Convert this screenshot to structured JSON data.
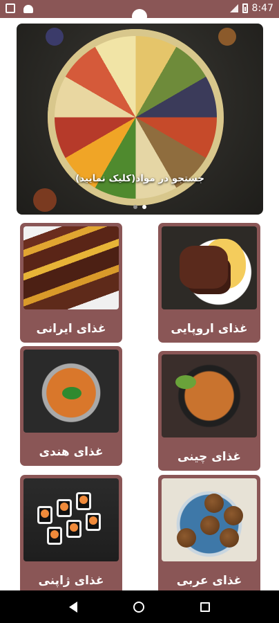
{
  "status_bar": {
    "time": "8:47",
    "icons": [
      "square-icon",
      "android-icon",
      "signal-icon",
      "battery-icon"
    ]
  },
  "hero": {
    "caption": "جستجو در مواد(کلیک نمایید)",
    "pages": 2,
    "active_page": 2
  },
  "categories": [
    {
      "label": "غذای اروپایی",
      "image": "european-dish"
    },
    {
      "label": "غذای ایرانی",
      "image": "iranian-kebab"
    },
    {
      "label": "غذای چینی",
      "image": "chinese-noodles"
    },
    {
      "label": "غذای هندی",
      "image": "indian-rice"
    },
    {
      "label": "غذای عربی",
      "image": "arabic-falafel"
    },
    {
      "label": "غذای ژاپنی",
      "image": "japanese-sushi"
    }
  ],
  "colors": {
    "primary": "#8a5656",
    "background": "#ffffff",
    "nav_bar": "#000000"
  },
  "nav": [
    "back-icon",
    "home-icon",
    "recent-apps-icon"
  ]
}
